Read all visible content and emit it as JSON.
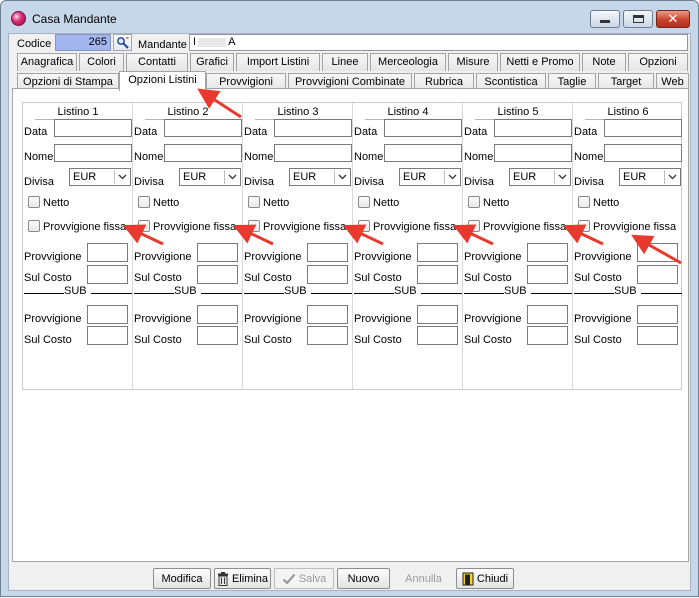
{
  "window": {
    "title": "Casa Mandante",
    "app_icon": "app-orb-icon",
    "controls": {
      "minimize": "minimize-icon",
      "maximize": "maximize-icon",
      "close": "close-icon"
    }
  },
  "header": {
    "codice_label": "Codice",
    "codice_value": "265",
    "lookup_icon": "lookup-magnifier-icon",
    "mandante_label": "Mandante",
    "mandante_value_start": "I",
    "mandante_value_end": "A"
  },
  "tabs_row1": [
    "Anagrafica",
    "Colori",
    "Contatti",
    "Grafici",
    "Import Listini",
    "Linee",
    "Merceologia",
    "Misure",
    "Netti e Promo",
    "Note",
    "Opzioni"
  ],
  "tabs_row2": [
    "Opzioni di Stampa",
    "Opzioni Listini",
    "Provvigioni",
    "Provvigioni Combinate",
    "Rubrica",
    "Scontistica",
    "Taglie",
    "Target",
    "Web"
  ],
  "active_tab": "Opzioni Listini",
  "listini": [
    {
      "title": "Listino 1",
      "divisa": "EUR"
    },
    {
      "title": "Listino 2",
      "divisa": "EUR"
    },
    {
      "title": "Listino 3",
      "divisa": "EUR"
    },
    {
      "title": "Listino 4",
      "divisa": "EUR"
    },
    {
      "title": "Listino 5",
      "divisa": "EUR"
    },
    {
      "title": "Listino 6",
      "divisa": "EUR"
    }
  ],
  "field_labels": {
    "data": "Data",
    "nome": "Nome",
    "divisa": "Divisa",
    "netto": "Netto",
    "provvigione_fissa": "Provvigione fissa",
    "provvigione": "Provvigione",
    "sul_costo": "Sul Costo",
    "sub": "SUB"
  },
  "buttons": {
    "modifica": "Modifica",
    "elimina": "Elimina",
    "salva": "Salva",
    "nuovo": "Nuovo",
    "annulla": "Annulla",
    "chiudi": "Chiudi"
  },
  "colors": {
    "codice_field_bg": "#a4b6f0",
    "window_frame": "#c6d7ea",
    "annotation_arrow": "#e8392f"
  }
}
